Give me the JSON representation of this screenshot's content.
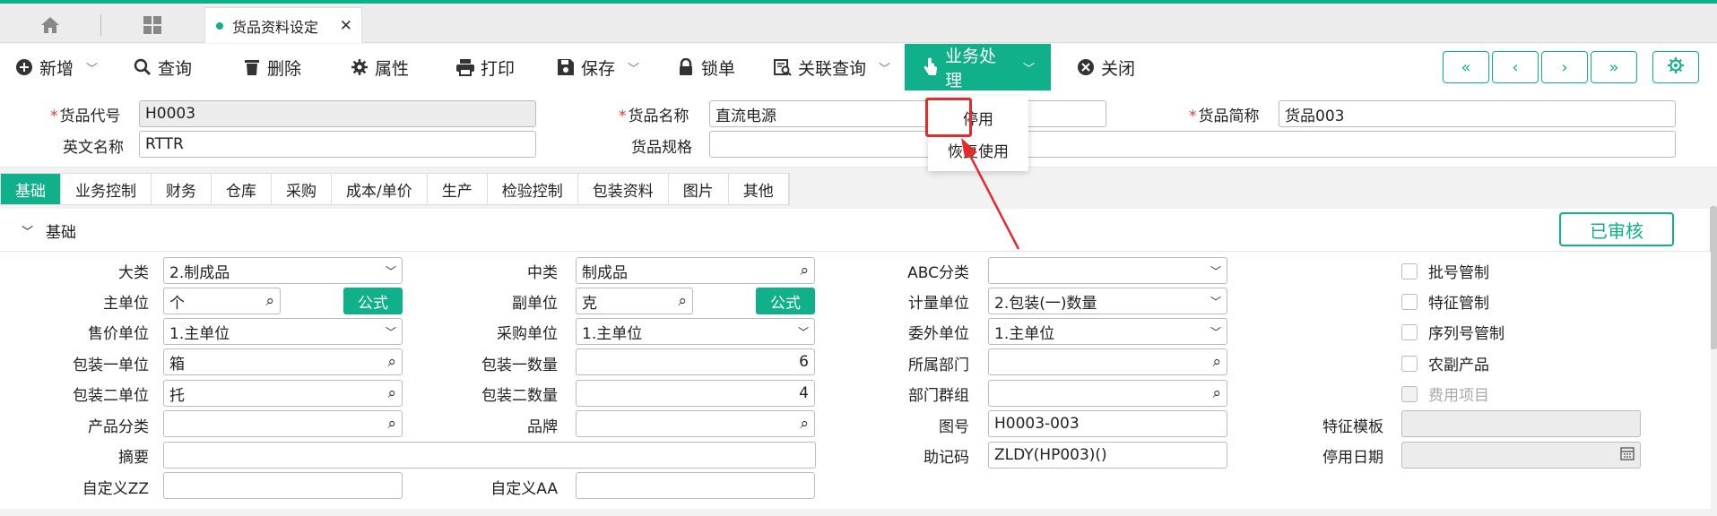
{
  "tabbar": {
    "doc_tab_label": "货品资料设定",
    "close_glyph": "✕"
  },
  "toolbar": {
    "new": "新增",
    "query": "查询",
    "delete": "删除",
    "properties": "属性",
    "print": "打印",
    "save": "保存",
    "lock": "锁单",
    "related_query": "关联查询",
    "business": "业务处理",
    "close": "关闭"
  },
  "business_menu": [
    "停用",
    "恢复使用"
  ],
  "header": {
    "code_label": "货品代号",
    "code_value": "H0003",
    "name_label": "货品名称",
    "name_value": "直流电源",
    "short_label": "货品简称",
    "short_value": "货品003",
    "en_label": "英文名称",
    "en_value": "RTTR",
    "spec_label": "货品规格",
    "spec_value": ""
  },
  "tabs": [
    "基础",
    "业务控制",
    "财务",
    "仓库",
    "采购",
    "成本/单价",
    "生产",
    "检验控制",
    "包装资料",
    "图片",
    "其他"
  ],
  "section": {
    "title": "基础",
    "approved": "已审核"
  },
  "fields": {
    "category_label": "大类",
    "category_value": "2.制成品",
    "mid_label": "中类",
    "mid_value": "制成品",
    "abc_label": "ABC分类",
    "abc_value": "",
    "main_unit_label": "主单位",
    "main_unit_value": "个",
    "formula1": "公式",
    "sub_unit_label": "副单位",
    "sub_unit_value": "克",
    "formula2": "公式",
    "measure_label": "计量单位",
    "measure_value": "2.包装(一)数量",
    "sale_unit_label": "售价单位",
    "sale_unit_value": "1.主单位",
    "purchase_unit_label": "采购单位",
    "purchase_unit_value": "1.主单位",
    "outsource_unit_label": "委外单位",
    "outsource_unit_value": "1.主单位",
    "pack1_label": "包装一单位",
    "pack1_value": "箱",
    "pack1_qty_label": "包装一数量",
    "pack1_qty_value": "6",
    "dept_label": "所属部门",
    "dept_value": "",
    "pack2_label": "包装二单位",
    "pack2_value": "托",
    "pack2_qty_label": "包装二数量",
    "pack2_qty_value": "4",
    "dept_group_label": "部门群组",
    "dept_group_value": "",
    "product_class_label": "产品分类",
    "product_class_value": "",
    "brand_label": "品牌",
    "brand_value": "",
    "drawing_label": "图号",
    "drawing_value": "H0003-003",
    "feature_tpl_label": "特征模板",
    "feature_tpl_value": "",
    "summary_label": "摘要",
    "summary_value": "",
    "mnemonic_label": "助记码",
    "mnemonic_value": "ZLDY(HP003)()",
    "stop_date_label": "停用日期",
    "stop_date_value": "",
    "custom_zz_label": "自定义ZZ",
    "custom_zz_value": "",
    "custom_aa_label": "自定义AA",
    "custom_aa_value": ""
  },
  "checks": {
    "batch": "批号管制",
    "feature": "特征管制",
    "serial": "序列号管制",
    "agri": "农副产品",
    "expense": "费用项目"
  },
  "colors": {
    "accent": "#10b08a",
    "annotation": "#e32b2b"
  }
}
